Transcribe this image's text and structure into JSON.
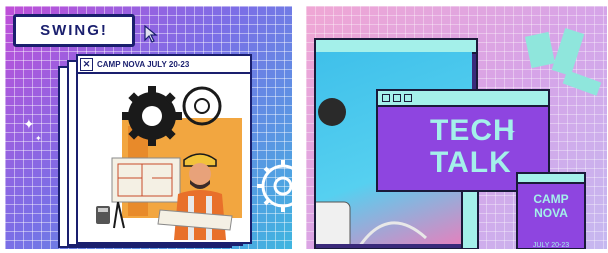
{
  "card1": {
    "button_label": "SWING!",
    "window_title": "CAMP NOVA JULY 20-23",
    "close_glyph": "✕"
  },
  "card2": {
    "title_line1": "TECH",
    "title_line2": "TALK",
    "badge_title": "CAMP NOVA",
    "badge_date": "JULY 20-23"
  },
  "colors": {
    "navy": "#1a1f6e",
    "mint": "#a4f0ea",
    "purple": "#8e45e0"
  }
}
